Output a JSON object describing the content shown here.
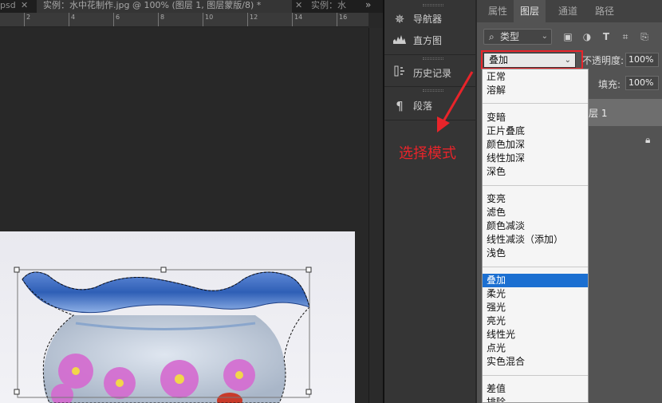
{
  "tabs": {
    "left_partial": "psd",
    "active": "实例：水中花制作.jpg @ 100% (图层 1, 图层蒙版/8) *",
    "next": "实例：水",
    "overflow": "»"
  },
  "ruler": {
    "labels": [
      "2",
      "4",
      "6",
      "8",
      "10",
      "12",
      "14",
      "16"
    ]
  },
  "icon_panel": {
    "items": [
      {
        "icon": "navigator-icon",
        "label": "导航器"
      },
      {
        "icon": "histogram-icon",
        "label": "直方图"
      },
      {
        "icon": "history-icon",
        "label": "历史记录"
      },
      {
        "icon": "paragraph-icon",
        "label": "段落"
      }
    ]
  },
  "layers_panel": {
    "tabs": [
      "属性",
      "图层",
      "通道",
      "路径"
    ],
    "active_tab": "图层",
    "filter": {
      "label": "类型"
    },
    "blend_mode": "叠加",
    "opacity": {
      "label": "不透明度:",
      "value": "100%"
    },
    "fill": {
      "label": "填充:",
      "value": "100%"
    },
    "layer_name_partial": "层 1"
  },
  "blend_list": {
    "groups": [
      [
        "正常",
        "溶解"
      ],
      [
        "变暗",
        "正片叠底",
        "颜色加深",
        "线性加深",
        "深色"
      ],
      [
        "变亮",
        "滤色",
        "颜色减淡",
        "线性减淡（添加）",
        "浅色"
      ],
      [
        "叠加",
        "柔光",
        "强光",
        "亮光",
        "线性光",
        "点光",
        "实色混合"
      ],
      [
        "差值",
        "排除"
      ]
    ],
    "selected": "叠加"
  },
  "annotation": {
    "text": "选择模式",
    "color": "#e8242a"
  },
  "colors": {
    "selection_blue": "#1b6fd1",
    "panel_bg": "#535353"
  }
}
